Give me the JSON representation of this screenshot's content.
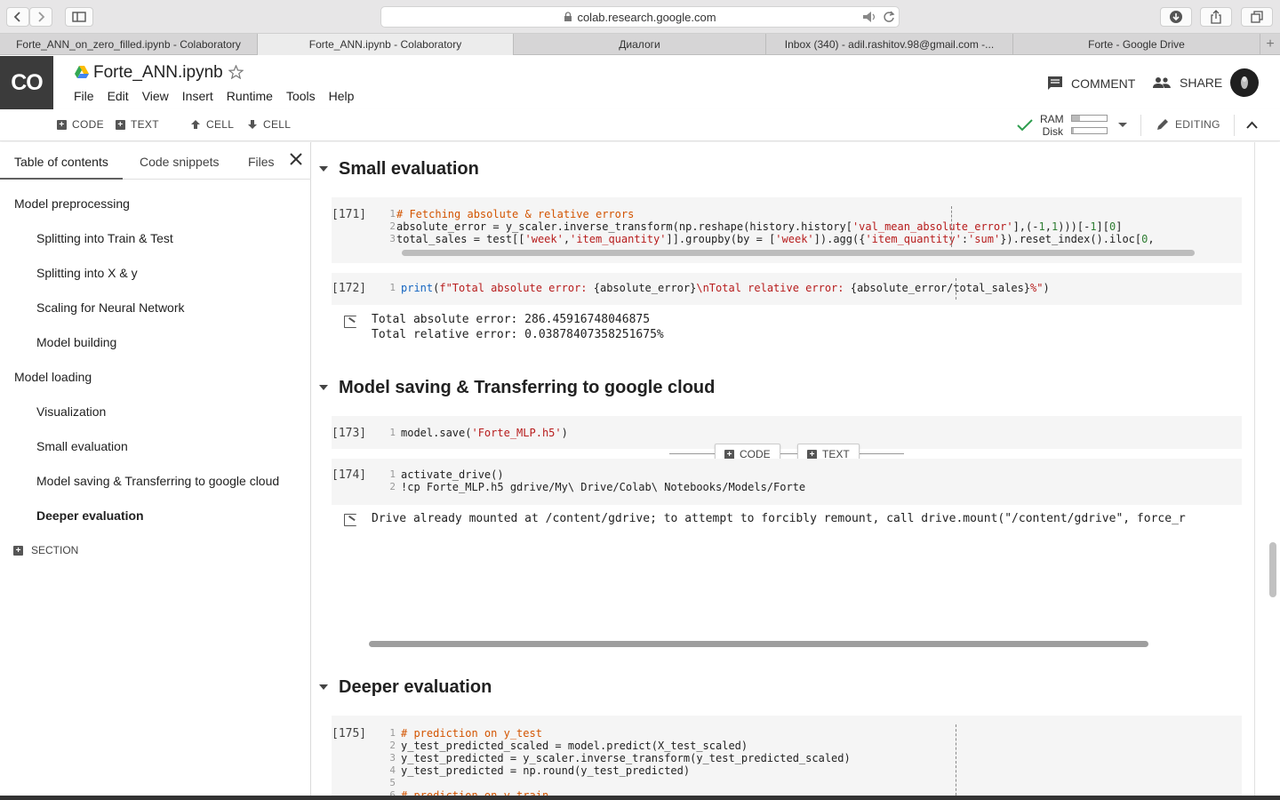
{
  "browser": {
    "url": "colab.research.google.com",
    "tabs": [
      "Forte_ANN_on_zero_filled.ipynb - Colaboratory",
      "Forte_ANN.ipynb - Colaboratory",
      "Диалоги",
      "Inbox (340) - adil.rashitov.98@gmail.com -...",
      "Forte - Google Drive"
    ]
  },
  "header": {
    "logo": "CO",
    "title": "Forte_ANN.ipynb",
    "menu": [
      "File",
      "Edit",
      "View",
      "Insert",
      "Runtime",
      "Tools",
      "Help"
    ],
    "comment": "COMMENT",
    "share": "SHARE"
  },
  "toolbar": {
    "code": "CODE",
    "text": "TEXT",
    "cell_up": "CELL",
    "cell_down": "CELL",
    "ram": "RAM",
    "disk": "Disk",
    "editing": "EDITING"
  },
  "sidebar": {
    "tabs": [
      "Table of contents",
      "Code snippets",
      "Files"
    ],
    "toc": [
      "Model preprocessing",
      "Splitting into Train & Test",
      "Splitting into X & y",
      "Scaling for Neural Network",
      "Model building",
      "Model loading",
      "Visualization",
      "Small evaluation",
      "Model saving & Transferring to google cloud",
      "Deeper evaluation"
    ],
    "section_btn": "SECTION"
  },
  "notebook": {
    "sections": [
      "Small evaluation",
      "Model saving & Transferring to google cloud",
      "Deeper evaluation"
    ],
    "cells": {
      "c171": {
        "exec": "[171]",
        "l1": "# Fetching absolute & relative errors",
        "l2a": "absolute_error = y_scaler.inverse_transform(np.reshape(history.history[",
        "l2b": "'val_mean_absolute_error'",
        "l2c": "],(-",
        "l2d": "1",
        "l2e": ",",
        "l2f": "1",
        "l2g": ")))[-",
        "l2h": "1",
        "l2i": "][",
        "l2j": "0",
        "l2k": "]",
        "l3a": "total_sales = test[[",
        "l3b": "'week'",
        "l3c": ",",
        "l3d": "'item_quantity'",
        "l3e": "]].groupby(by = [",
        "l3f": "'week'",
        "l3g": "]).agg({",
        "l3h": "'item_quantity'",
        "l3i": ":",
        "l3j": "'sum'",
        "l3k": "}).reset_index().iloc[",
        "l3l": "0",
        "l3m": ","
      },
      "c172": {
        "exec": "[172]",
        "l1a": "print",
        "l1b": "(",
        "l1c": "f\"Total absolute error: ",
        "l1d": "{absolute_error}",
        "l1e": "\\nTotal relative error: ",
        "l1f": "{absolute_error/total_sales}",
        "l1g": "%\"",
        "l1h": ")",
        "out1": "Total absolute error: 286.45916748046875",
        "out2": "Total relative error: 0.03878407358251675%"
      },
      "c173": {
        "exec": "[173]",
        "l1a": "model.save(",
        "l1b": "'Forte_MLP.h5'",
        "l1c": ")"
      },
      "c174": {
        "exec": "[174]",
        "l1": "activate_drive()",
        "l2": "!cp Forte_MLP.h5 gdrive/My\\ Drive/Colab\\ Notebooks/Models/Forte",
        "out": "Drive already mounted at /content/gdrive; to attempt to forcibly remount, call drive.mount(\"/content/gdrive\", force_r"
      },
      "c175": {
        "exec": "[175]",
        "l1": "# prediction on y_test",
        "l2": "y_test_predicted_scaled = model.predict(X_test_scaled)",
        "l3": "y_test_predicted = y_scaler.inverse_transform(y_test_predicted_scaled)",
        "l4": "y_test_predicted = np.round(y_test_predicted)",
        "l6": "# prediction on y_train"
      }
    },
    "insert_code": "CODE",
    "insert_text": "TEXT",
    "line_numbers": [
      "1",
      "2",
      "3",
      "4",
      "5",
      "6"
    ]
  }
}
